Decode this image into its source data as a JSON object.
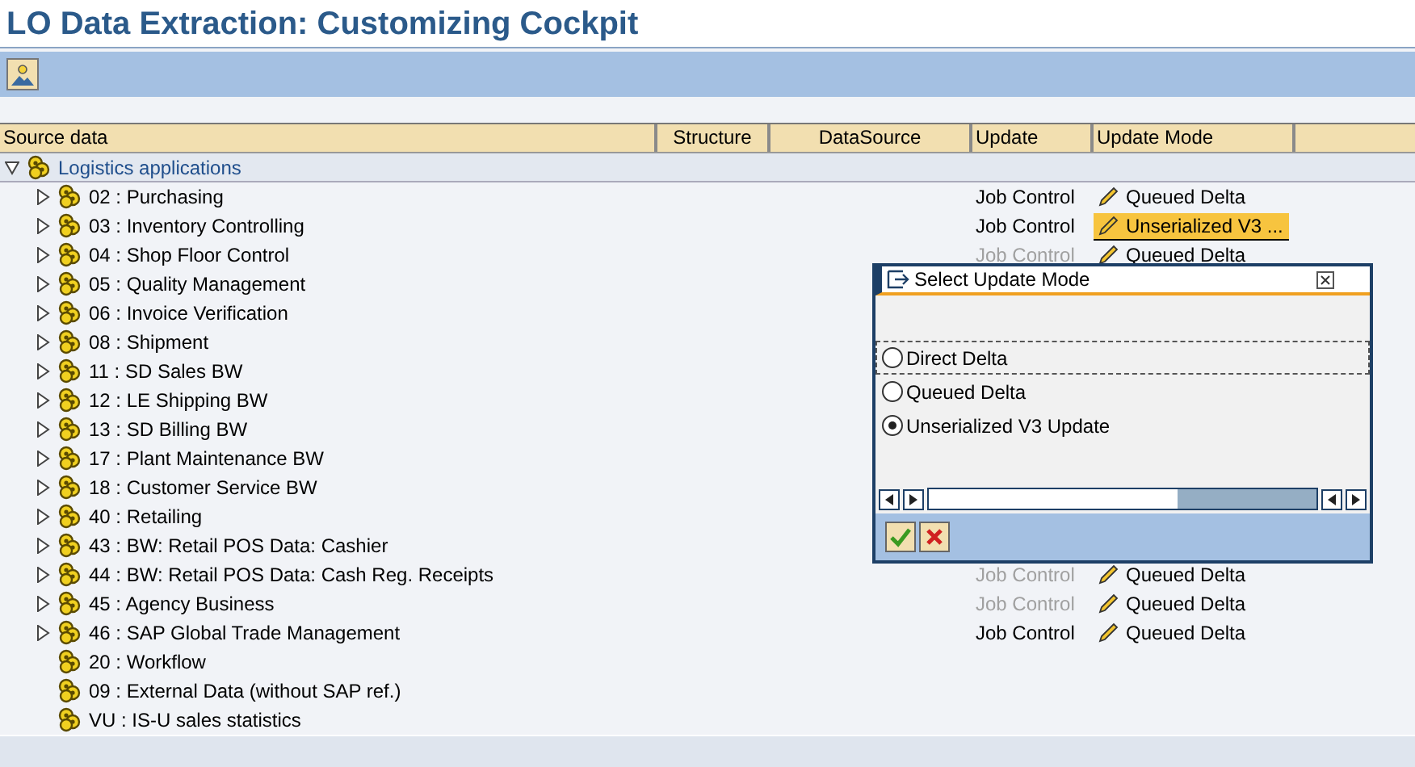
{
  "window": {
    "title": "LO Data Extraction: Customizing Cockpit"
  },
  "table": {
    "columns": [
      "Source data",
      "Structure",
      "DataSource",
      "Update",
      "Update Mode"
    ],
    "root": {
      "label": "Logistics applications",
      "expanded": true,
      "children": [
        {
          "kind": "node",
          "expanded": false,
          "label": "02 : Purchasing",
          "update": {
            "text": "Job Control",
            "disabled": false
          },
          "mode": {
            "text": "Queued Delta",
            "selected": false
          }
        },
        {
          "kind": "node",
          "expanded": false,
          "label": "03 : Inventory Controlling",
          "update": {
            "text": "Job Control",
            "disabled": false
          },
          "mode": {
            "text": "Unserialized V3 ...",
            "selected": true
          }
        },
        {
          "kind": "node",
          "expanded": false,
          "label": "04 : Shop Floor Control",
          "update": {
            "text": "Job Control",
            "disabled": true
          },
          "mode": {
            "text": "Queued Delta",
            "selected": false
          }
        },
        {
          "kind": "node",
          "expanded": false,
          "label": "05 : Quality Management"
        },
        {
          "kind": "node",
          "expanded": false,
          "label": "06 : Invoice Verification"
        },
        {
          "kind": "node",
          "expanded": false,
          "label": "08 : Shipment"
        },
        {
          "kind": "node",
          "expanded": false,
          "label": "11 : SD Sales BW"
        },
        {
          "kind": "node",
          "expanded": false,
          "label": "12 : LE Shipping BW"
        },
        {
          "kind": "node",
          "expanded": false,
          "label": "13 : SD Billing BW"
        },
        {
          "kind": "node",
          "expanded": false,
          "label": "17 : Plant Maintenance BW"
        },
        {
          "kind": "node",
          "expanded": false,
          "label": "18 : Customer Service BW"
        },
        {
          "kind": "node",
          "expanded": false,
          "label": "40 : Retailing"
        },
        {
          "kind": "node",
          "expanded": false,
          "label": "43 : BW: Retail POS Data: Cashier"
        },
        {
          "kind": "node",
          "expanded": false,
          "label": "44 : BW: Retail POS Data: Cash Reg. Receipts",
          "update": {
            "text": "Job Control",
            "disabled": true
          },
          "mode": {
            "text": "Queued Delta",
            "selected": false
          }
        },
        {
          "kind": "node",
          "expanded": false,
          "label": "45 : Agency Business",
          "update": {
            "text": "Job Control",
            "disabled": true
          },
          "mode": {
            "text": "Queued Delta",
            "selected": false
          }
        },
        {
          "kind": "node",
          "expanded": false,
          "label": "46 : SAP Global Trade Management",
          "update": {
            "text": "Job Control",
            "disabled": false
          },
          "mode": {
            "text": "Queued Delta",
            "selected": false
          }
        },
        {
          "kind": "leaf",
          "label": "20 : Workflow"
        },
        {
          "kind": "leaf",
          "label": "09 : External Data (without SAP ref.)"
        },
        {
          "kind": "leaf",
          "label": "VU : IS-U sales statistics"
        }
      ]
    }
  },
  "dialog": {
    "title": "Select Update Mode",
    "options": [
      {
        "label": "Direct Delta",
        "selected": false,
        "focused": true
      },
      {
        "label": "Queued Delta",
        "selected": false,
        "focused": false
      },
      {
        "label": "Unserialized V3 Update",
        "selected": true,
        "focused": false
      }
    ]
  }
}
